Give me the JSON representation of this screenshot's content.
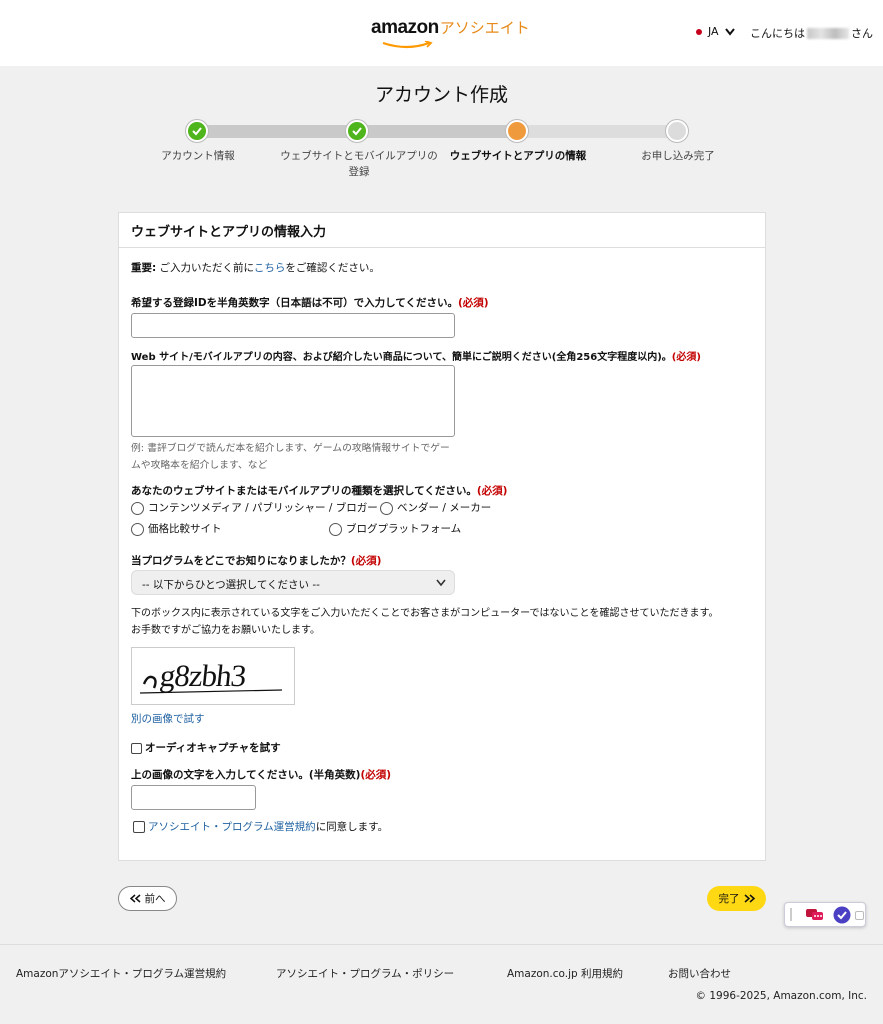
{
  "header": {
    "brand": "amazon",
    "brand_suffix": "アソシエイト",
    "language": "JA",
    "greeting_prefix": "こんにちは",
    "greeting_suffix": "さん"
  },
  "page_title": "アカウント作成",
  "steps": [
    {
      "label": "アカウント情報",
      "state": "done"
    },
    {
      "label": "ウェブサイトとモバイルアプリの登録",
      "state": "done"
    },
    {
      "label": "ウェブサイトとアプリの情報",
      "state": "current"
    },
    {
      "label": "お申し込み完了",
      "state": "todo"
    }
  ],
  "form": {
    "title": "ウェブサイトとアプリの情報入力",
    "notice_strong": "重要:",
    "notice_pre": " ご入力いただく前に",
    "notice_link": "こちら",
    "notice_post": "をご確認ください。",
    "field_id_label": "希望する登録IDを半角英数字（日本語は不可）で入力してください。",
    "required": "(必須)",
    "field_id_value": "",
    "field_desc_label": "Web サイト/モバイルアプリの内容、および紹介したい商品について、簡単にご説明ください(全角256文字程度以内)。",
    "field_desc_value": "",
    "field_desc_hint_1": "例: 書評ブログで読んだ本を紹介します、ゲームの攻略情報サイトでゲー",
    "field_desc_hint_2": "ムや攻略本を紹介します、など",
    "type_label": "あなたのウェブサイトまたはモバイルアプリの種類を選択してください。",
    "type_options": [
      "コンテンツメディア / パブリッシャー / ブロガー",
      "ベンダー / メーカー",
      "価格比較サイト",
      "ブログプラットフォーム"
    ],
    "source_label": "当プログラムをどこでお知りになりましたか？",
    "source_selected": "-- 以下からひとつ選択してください --",
    "captcha_intro_1": "下のボックス内に表示されている文字をご入力いただくことでお客さまがコンピューターではないことを確認させていただきます。",
    "captcha_intro_2": "お手数ですがご協力をお願いいたします。",
    "captcha_text": "g8zbh3",
    "captcha_retry": "別の画像で試す",
    "audio_captcha": "オーディオキャプチャを試す",
    "captcha_input_label": "上の画像の文字を入力してください。(半角英数)",
    "captcha_input_value": "",
    "agree_link": "アソシエイト・プログラム運営規約",
    "agree_post": "に同意します。"
  },
  "nav": {
    "prev": "前へ",
    "done": "完了"
  },
  "footer": {
    "links": [
      "Amazonアソシエイト・プログラム運営規約",
      "アソシエイト・プログラム・ポリシー",
      "Amazon.co.jp 利用規約",
      "お問い合わせ"
    ],
    "copyright": "© 1996-2025, Amazon.com, Inc."
  }
}
